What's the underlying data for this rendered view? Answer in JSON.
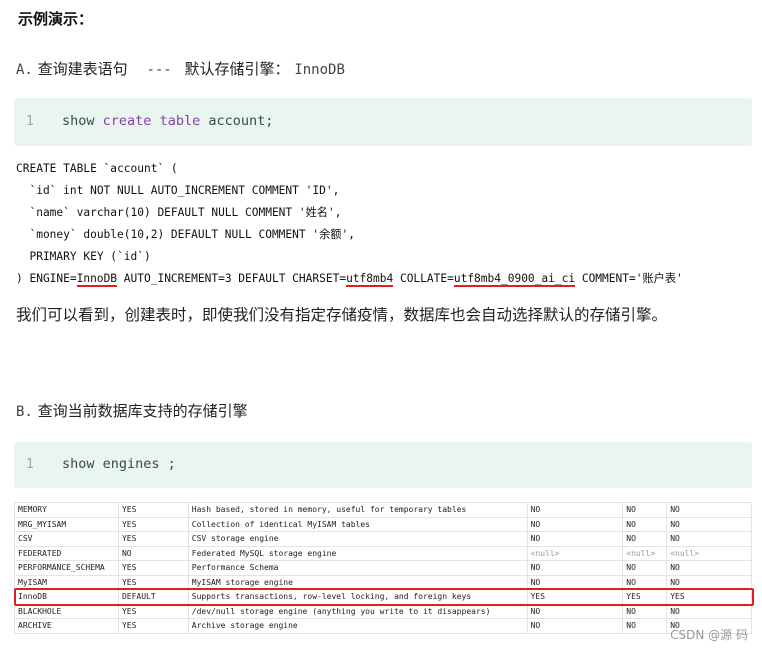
{
  "heading": "示例演示：",
  "section_a": {
    "letter": "A.",
    "title": "查询建表语句",
    "dashes": "---",
    "subtitle": "默认存储引擎：",
    "engine": "InnoDB"
  },
  "code_a": {
    "line_no": "1",
    "kw1": "show",
    "kw2": "create",
    "kw3": "table",
    "rest": "account;"
  },
  "create_sql": {
    "l1": "CREATE TABLE `account` (",
    "l2": "  `id` int NOT NULL AUTO_INCREMENT COMMENT 'ID',",
    "l3": "  `name` varchar(10) DEFAULT NULL COMMENT '姓名',",
    "l4": "  `money` double(10,2) DEFAULT NULL COMMENT '余额',",
    "l5": "  PRIMARY KEY (`id`)",
    "l6_prefix": ") ENGINE=",
    "l6_engine": "InnoDB",
    "l6_mid1": " AUTO_INCREMENT=3 DEFAULT CHARSET=",
    "l6_charset": "utf8mb4",
    "l6_mid2": " COLLATE=",
    "l6_collate": "utf8mb4_0900_ai_ci",
    "l6_suffix": " COMMENT='账户表'"
  },
  "paragraph": "我们可以看到，创建表时，即使我们没有指定存储疫情，数据库也会自动选择默认的存储引擎。",
  "section_b": {
    "letter": "B.",
    "title": "查询当前数据库支持的存储引擎"
  },
  "code_b": {
    "line_no": "1",
    "text": "show engines ;"
  },
  "engines": [
    {
      "engine": "MEMORY",
      "support": "YES",
      "comment": "Hash based, stored in memory, useful for temporary tables",
      "transactions": "NO",
      "xa": "NO",
      "savepoints": "NO"
    },
    {
      "engine": "MRG_MYISAM",
      "support": "YES",
      "comment": "Collection of identical MyISAM tables",
      "transactions": "NO",
      "xa": "NO",
      "savepoints": "NO"
    },
    {
      "engine": "CSV",
      "support": "YES",
      "comment": "CSV storage engine",
      "transactions": "NO",
      "xa": "NO",
      "savepoints": "NO"
    },
    {
      "engine": "FEDERATED",
      "support": "NO",
      "comment": "Federated MySQL storage engine",
      "transactions": "<null>",
      "xa": "<null>",
      "savepoints": "<null>"
    },
    {
      "engine": "PERFORMANCE_SCHEMA",
      "support": "YES",
      "comment": "Performance Schema",
      "transactions": "NO",
      "xa": "NO",
      "savepoints": "NO"
    },
    {
      "engine": "MyISAM",
      "support": "YES",
      "comment": "MyISAM storage engine",
      "transactions": "NO",
      "xa": "NO",
      "savepoints": "NO"
    },
    {
      "engine": "InnoDB",
      "support": "DEFAULT",
      "comment": "Supports transactions, row-level locking, and foreign keys",
      "transactions": "YES",
      "xa": "YES",
      "savepoints": "YES"
    },
    {
      "engine": "BLACKHOLE",
      "support": "YES",
      "comment": "/dev/null storage engine (anything you write to it disappears)",
      "transactions": "NO",
      "xa": "NO",
      "savepoints": "NO"
    },
    {
      "engine": "ARCHIVE",
      "support": "YES",
      "comment": "Archive storage engine",
      "transactions": "NO",
      "xa": "NO",
      "savepoints": "NO"
    }
  ],
  "watermark": "CSDN @源  码",
  "colors": {
    "code_bg": "#e9f5ef",
    "keyword": "#8a3fa8",
    "highlight": "#e02020"
  }
}
